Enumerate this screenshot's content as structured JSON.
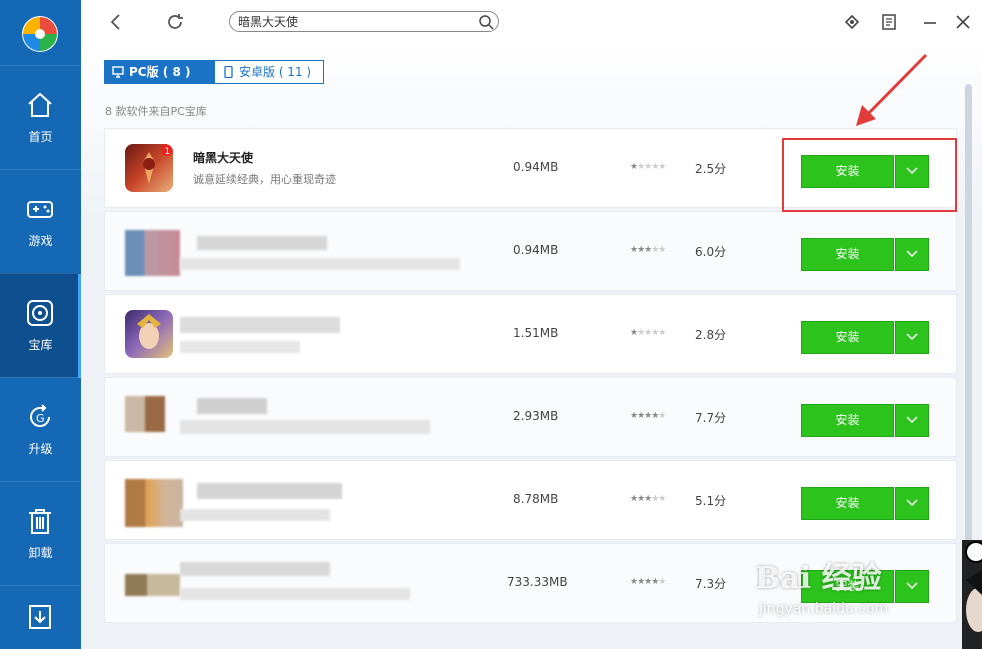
{
  "sidebar": {
    "items": [
      {
        "label": "首页",
        "icon": "home-icon"
      },
      {
        "label": "游戏",
        "icon": "gamepad-icon"
      },
      {
        "label": "宝库",
        "icon": "disc-icon",
        "active": true
      },
      {
        "label": "升级",
        "icon": "upgrade-icon"
      },
      {
        "label": "卸载",
        "icon": "trash-icon"
      },
      {
        "label": "",
        "icon": "download-icon"
      }
    ]
  },
  "search": {
    "value": "暗黑大天使"
  },
  "tabs": {
    "pc": "PC版 ( 8 )",
    "android": "安卓版 ( 11 )"
  },
  "source_note": "8 款软件来自PC宝库",
  "rows": [
    {
      "name": "暗黑大天使",
      "desc": "诚意延续经典，用心重现奇迹",
      "size": "0.94MB",
      "rating": 1,
      "score": "2.5分",
      "install": "安装",
      "badge": "1"
    },
    {
      "name": "",
      "desc": "",
      "size": "0.94MB",
      "rating": 3,
      "score": "6.0分",
      "install": "安装"
    },
    {
      "name": "",
      "desc": "",
      "size": "1.51MB",
      "rating": 1,
      "score": "2.8分",
      "install": "安装"
    },
    {
      "name": "",
      "desc": "",
      "size": "2.93MB",
      "rating": 4,
      "score": "7.7分",
      "install": "安装"
    },
    {
      "name": "",
      "desc": "",
      "size": "8.78MB",
      "rating": 3,
      "score": "5.1分",
      "install": "安装"
    },
    {
      "name": "",
      "desc": "",
      "size": "733.33MB",
      "rating": 4,
      "score": "7.3分",
      "install": "安装"
    }
  ],
  "watermark": {
    "brand": "Bai 经验",
    "url": "jingyan.baidu.com"
  },
  "colors": {
    "sidebar": "#1468b4",
    "install": "#2bc31c",
    "highlight": "#e23b3b",
    "tab": "#1a73c4"
  }
}
